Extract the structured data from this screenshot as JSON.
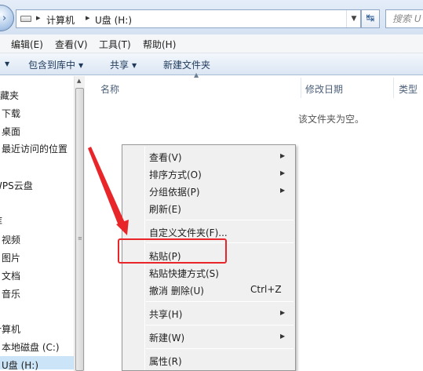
{
  "address": {
    "crumbs": [
      "计算机",
      "U盘 (H:)"
    ],
    "search_placeholder": "搜索 U"
  },
  "menu_bar": [
    "编辑(E)",
    "查看(V)",
    "工具(T)",
    "帮助(H)"
  ],
  "command_bar": {
    "include_library": "包含到库中",
    "share": "共享",
    "new_folder": "新建文件夹"
  },
  "nav_pane": [
    "收藏夹",
    "下载",
    "桌面",
    "最近访问的位置",
    "WPS云盘",
    "库",
    "视频",
    "图片",
    "文档",
    "音乐",
    "计算机",
    "本地磁盘 (C:)",
    "U盘 (H:)"
  ],
  "columns": [
    "名称",
    "修改日期",
    "类型"
  ],
  "empty_message": "该文件夹为空。",
  "context_menu": [
    {
      "label": "查看(V)",
      "submenu": true
    },
    {
      "label": "排序方式(O)",
      "submenu": true
    },
    {
      "label": "分组依据(P)",
      "submenu": true
    },
    {
      "label": "刷新(E)",
      "submenu": false
    },
    {
      "label": "自定义文件夹(F)...",
      "submenu": false
    },
    {
      "label": "粘贴(P)",
      "submenu": false
    },
    {
      "label": "粘贴快捷方式(S)",
      "submenu": false
    },
    {
      "label": "撤消 删除(U)",
      "shortcut": "Ctrl+Z",
      "submenu": false
    },
    {
      "label": "共享(H)",
      "submenu": true
    },
    {
      "label": "新建(W)",
      "submenu": true
    },
    {
      "label": "属性(R)",
      "submenu": false
    }
  ],
  "annotation_color": "#e8262a",
  "selection_color": "#cce4f7"
}
